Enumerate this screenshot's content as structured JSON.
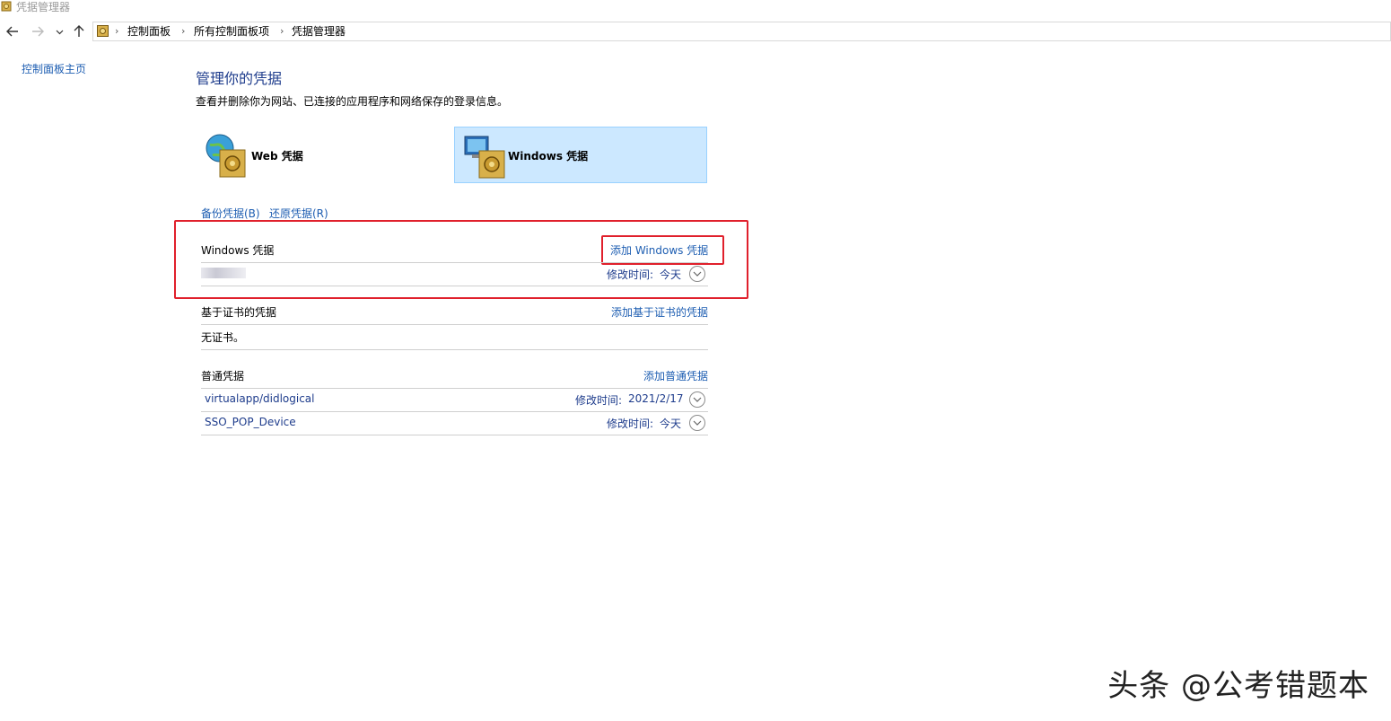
{
  "window": {
    "title": "凭据管理器"
  },
  "breadcrumb": [
    "控制面板",
    "所有控制面板项",
    "凭据管理器"
  ],
  "sidebar": {
    "home_link": "控制面板主页"
  },
  "main": {
    "title": "管理你的凭据",
    "description": "查看并删除你为网站、已连接的应用程序和网络保存的登录信息。",
    "tiles": [
      {
        "label": "Web 凭据",
        "selected": false,
        "icon": "globe-vault-icon"
      },
      {
        "label": "Windows 凭据",
        "selected": true,
        "icon": "monitor-vault-icon"
      }
    ],
    "backup_link": "备份凭据(B)",
    "restore_link": "还原凭据(R)"
  },
  "sections": {
    "windows": {
      "title": "Windows 凭据",
      "add_link": "添加 Windows 凭据",
      "entries": [
        {
          "name_redacted": true,
          "modified_label": "修改时间:",
          "modified_value": "今天"
        }
      ]
    },
    "certificate": {
      "title": "基于证书的凭据",
      "add_link": "添加基于证书的凭据",
      "empty_text": "无证书。"
    },
    "generic": {
      "title": "普通凭据",
      "add_link": "添加普通凭据",
      "entries": [
        {
          "name": "virtualapp/didlogical",
          "modified_label": "修改时间:",
          "modified_value": "2021/2/17"
        },
        {
          "name": "SSO_POP_Device",
          "modified_label": "修改时间:",
          "modified_value": "今天"
        }
      ]
    }
  },
  "watermark": "头条 @公考错题本",
  "colors": {
    "link": "#1e5eb2",
    "title": "#1e3c8c",
    "highlight": "#e0202c",
    "selected_tile": "#cce8ff"
  }
}
